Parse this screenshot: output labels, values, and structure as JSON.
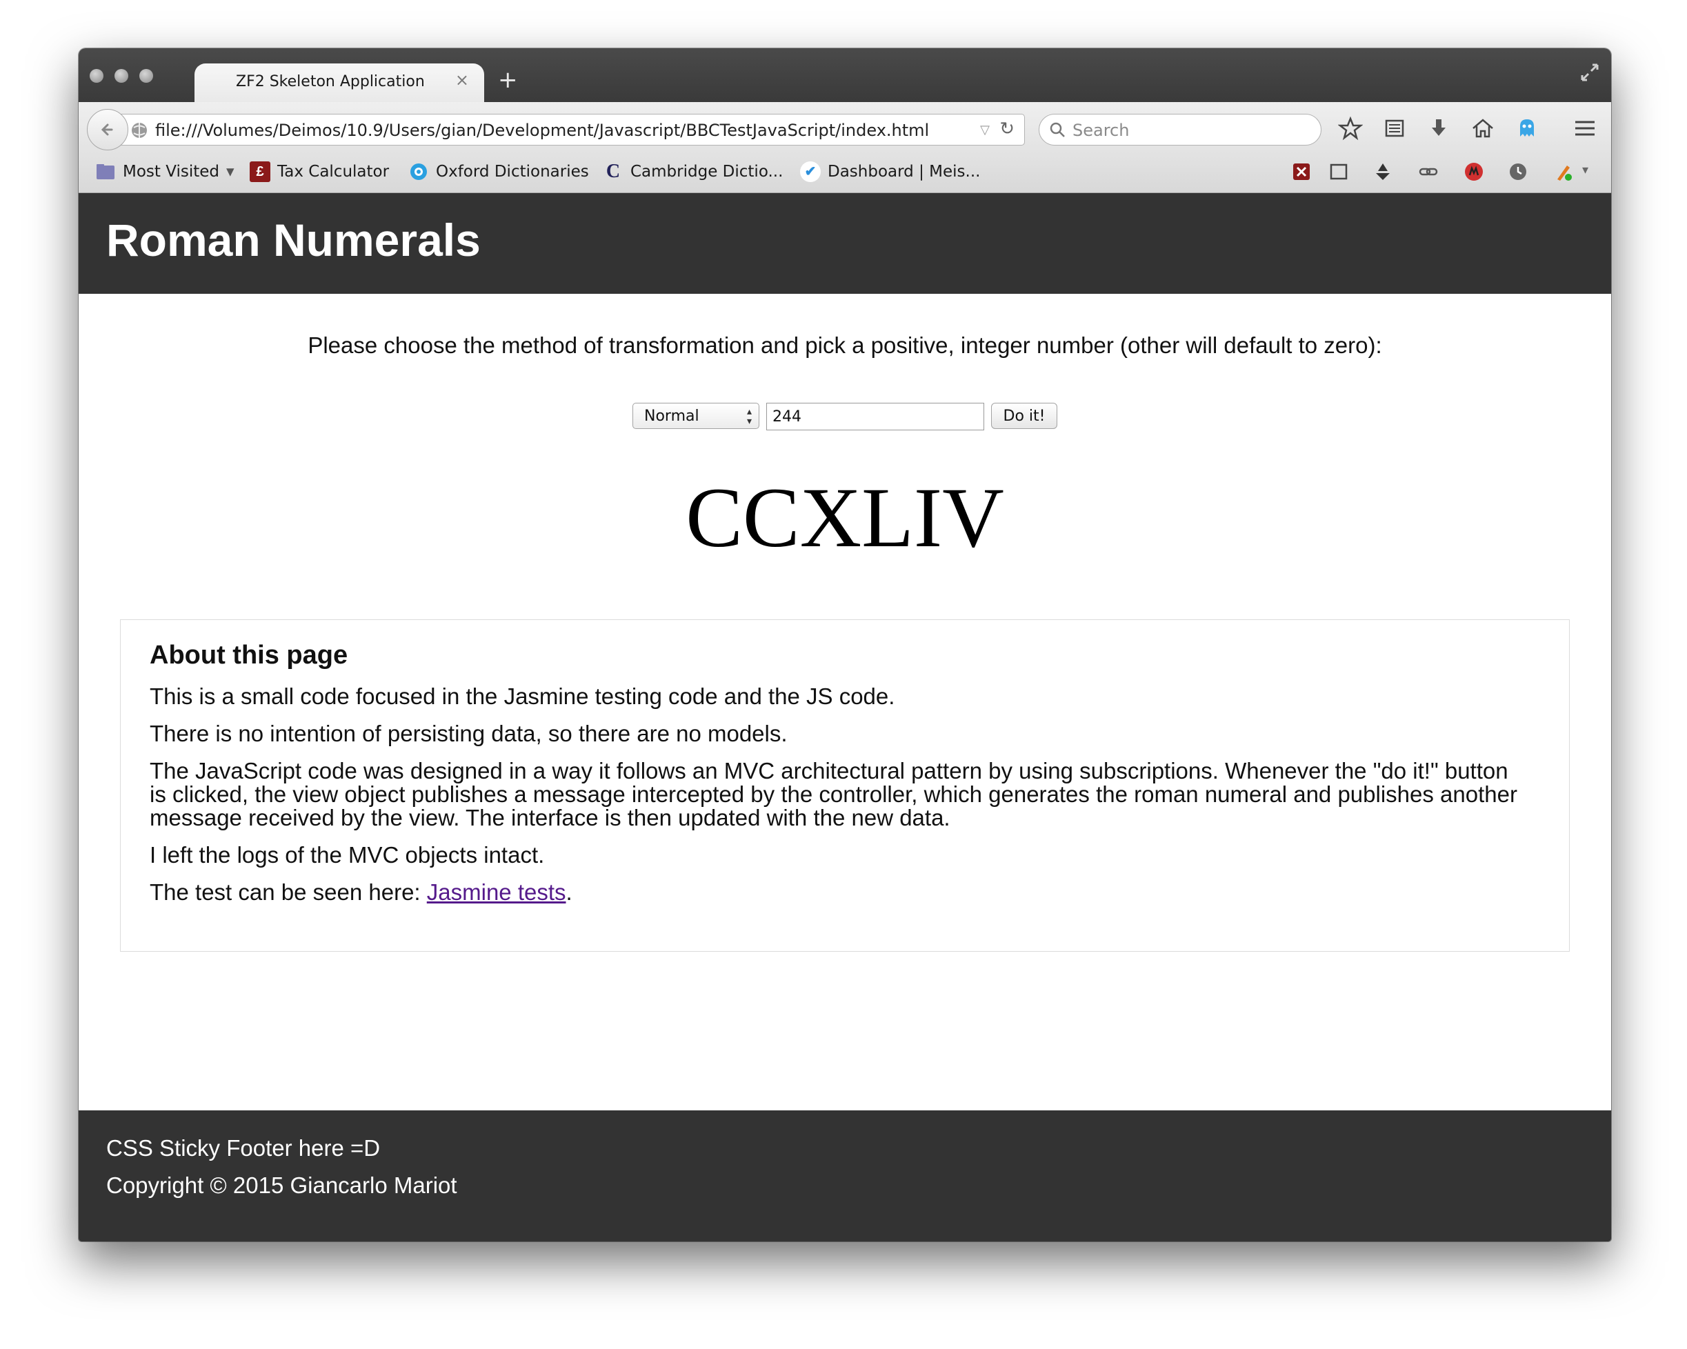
{
  "browser": {
    "tab_title": "ZF2 Skeleton Application",
    "tab_close": "×",
    "new_tab": "+",
    "url": "file:///Volumes/Deimos/10.9/Users/gian/Development/Javascript/BBCTestJavaScript/index.html",
    "search_placeholder": "Search",
    "reload_glyph": "↻",
    "icons": [
      "star-icon",
      "reading-list-icon",
      "download-icon",
      "home-icon",
      "ghost-icon",
      "menu-icon"
    ]
  },
  "bookmarks": {
    "items": [
      {
        "label": "Most Visited",
        "icon": "folder-icon",
        "dropdown": "▾"
      },
      {
        "label": "Tax Calculator",
        "icon": "pound-icon",
        "glyph": "£"
      },
      {
        "label": "Oxford Dictionaries",
        "icon": "oxford-icon"
      },
      {
        "label": "Cambridge Dictio...",
        "icon": "cambridge-icon",
        "glyph": "C"
      },
      {
        "label": "Dashboard | Meis...",
        "icon": "check-icon",
        "glyph": "✔"
      }
    ],
    "addons": [
      "close-x-icon",
      "window-icon",
      "bell-icon",
      "link-icon",
      "adblock-icon",
      "history-icon",
      "pen-icon"
    ]
  },
  "page": {
    "site_title": "Roman Numerals",
    "intro": "Please choose the method of transformation and pick a positive, integer number (other will default to zero):",
    "method": {
      "selected": "Normal"
    },
    "number_value": "244",
    "button_label": "Do it!",
    "result": "CCXLIV",
    "about": {
      "heading": "About this page",
      "p1": "This is a small code focused in the Jasmine testing code and the JS code.",
      "p2": "There is no intention of persisting data, so there are no models.",
      "p3": "The JavaScript code was designed in a way it follows an MVC architectural pattern by using subscriptions. Whenever the \"do it!\" button is clicked, the view object publishes a message intercepted by the controller, which generates the roman numeral and publishes another message received by the view. The interface is then updated with the new data.",
      "p4": "I left the logs of the MVC objects intact.",
      "p5_prefix": "The test can be seen here: ",
      "p5_link": "Jasmine tests",
      "p5_suffix": "."
    },
    "footer": {
      "line1": "CSS Sticky Footer here =D",
      "line2": "Copyright © 2015 Giancarlo Mariot"
    }
  },
  "colors": {
    "header_bg": "#333333",
    "link": "#551a8b"
  }
}
